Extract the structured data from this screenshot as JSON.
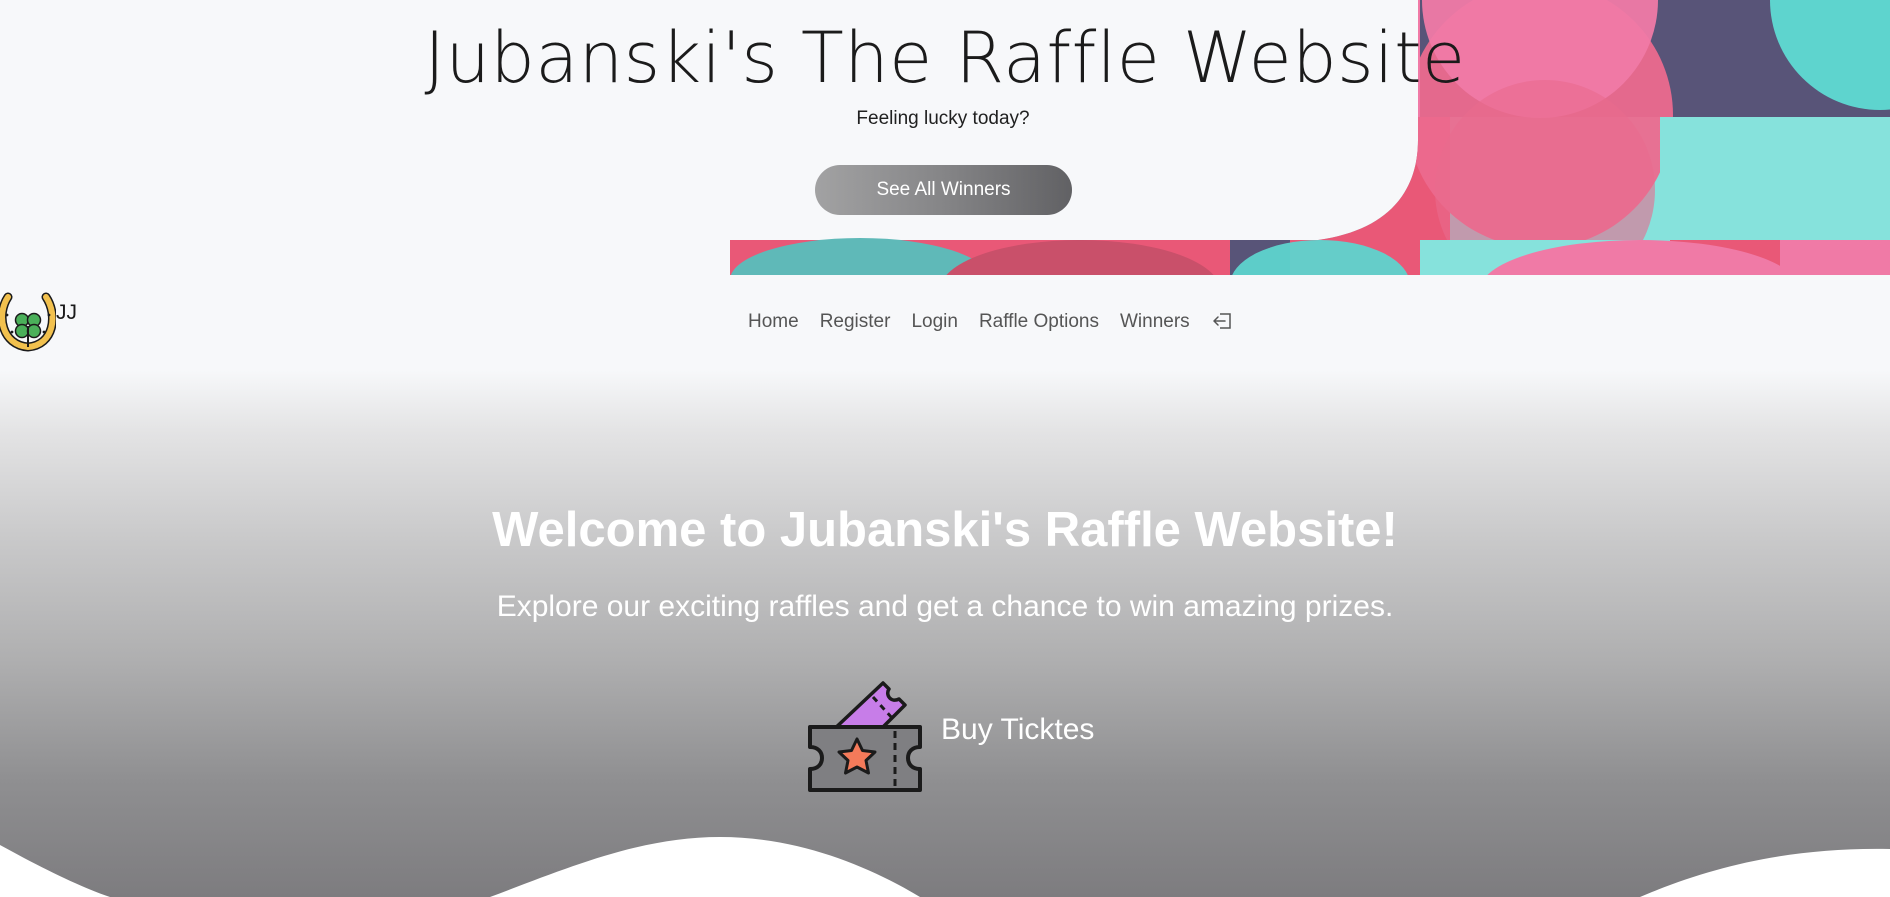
{
  "header": {
    "title": "Jubanski's The Raffle Website",
    "tagline": "Feeling lucky today?",
    "winners_button_label": "See All Winners"
  },
  "brand": {
    "logo_icon": "horseshoe-clover-icon",
    "text": "JJ"
  },
  "nav": {
    "items": [
      {
        "label": "Home"
      },
      {
        "label": "Register"
      },
      {
        "label": "Login"
      },
      {
        "label": "Raffle Options"
      },
      {
        "label": "Winners"
      }
    ],
    "logout_icon": "logout-icon"
  },
  "main": {
    "welcome_heading": "Welcome to Jubanski's Raffle Website!",
    "subtitle": "Explore our exciting raffles and get a chance to win amazing prizes.",
    "buy_label": "Buy Ticktes",
    "buy_icon": "ticket-icon"
  },
  "colors": {
    "pink": "#f07aa6",
    "rose": "#e95877",
    "teal": "#5ed4ce",
    "navy": "#585478",
    "button_gradient_start": "#a2a2a3",
    "button_gradient_end": "#616164"
  }
}
